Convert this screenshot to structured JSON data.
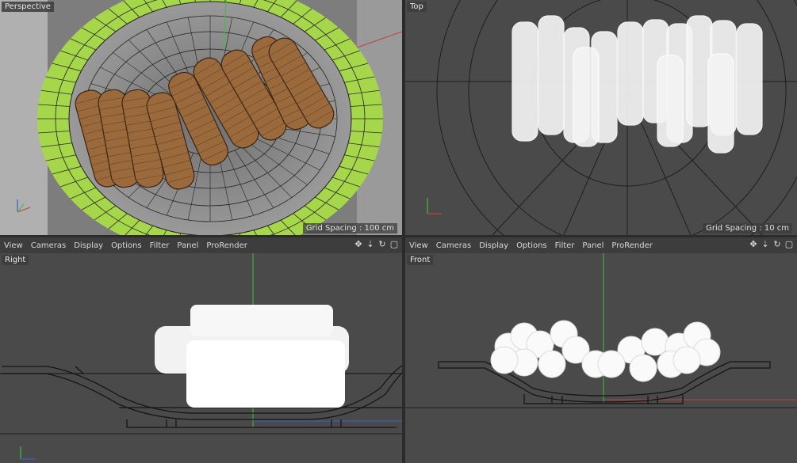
{
  "menu": [
    "View",
    "Cameras",
    "Display",
    "Options",
    "Filter",
    "Panel",
    "ProRender"
  ],
  "nav_icons": [
    "move-icon",
    "zoom-icon",
    "rotate-icon",
    "maximize-icon"
  ],
  "viewports": {
    "perspective": {
      "title": "Perspective",
      "grid": "Grid Spacing : 100 cm"
    },
    "top": {
      "title": "Top",
      "grid": "Grid Spacing : 10 cm"
    },
    "right": {
      "title": "Right"
    },
    "front": {
      "title": "Front"
    }
  },
  "colors": {
    "accent_green": "#a6d64a",
    "wood": "#9a6a3d",
    "wire": "#ffffff",
    "axis_x": "#c04040",
    "axis_y": "#3fbf3f",
    "axis_z": "#3a5fd0"
  }
}
